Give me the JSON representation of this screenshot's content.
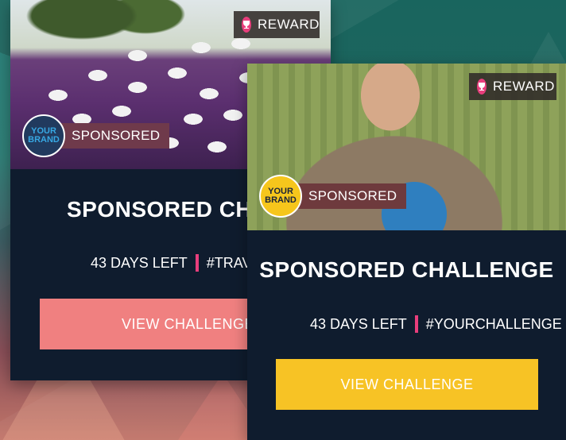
{
  "cards": [
    {
      "reward_label": "REWARD",
      "brand_logo_line1": "YOUR",
      "brand_logo_line2": "BRAND",
      "sponsored_label": "SPONSORED",
      "title": "SPONSORED CHALLENGE",
      "days_left": "43 DAYS LEFT",
      "hashtag": "#TRAVEL BU",
      "cta_label": "VIEW CHALLENGE",
      "accent_color": "#f08080"
    },
    {
      "reward_label": "REWARD",
      "brand_logo_line1": "YOUR",
      "brand_logo_line2": "BRAND",
      "sponsored_label": "SPONSORED",
      "title": "SPONSORED CHALLENGE",
      "days_left": "43 DAYS LEFT",
      "hashtag": "#YOURCHALLENGE",
      "cta_label": "VIEW CHALLENGE",
      "accent_color": "#f7c325"
    }
  ],
  "colors": {
    "card_background": "#0f1c2e",
    "divider": "#e83e7c",
    "trophy": "#e83e7c"
  }
}
